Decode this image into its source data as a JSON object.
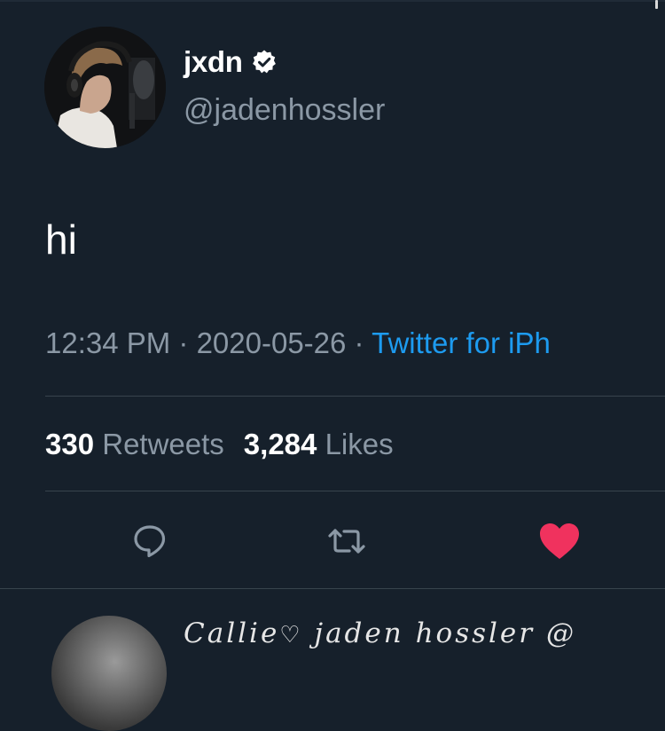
{
  "tweet": {
    "display_name": "jxdn",
    "handle": "@jadenhossler",
    "text": "hi",
    "time": "12:34 PM",
    "separator1": " · ",
    "date": "2020-05-26",
    "separator2": " · ",
    "source": "Twitter for iPh"
  },
  "stats": {
    "retweets_count": "330",
    "retweets_label": "Retweets",
    "likes_count": "3,284",
    "likes_label": "Likes"
  },
  "reply_preview": {
    "name": "Callie",
    "heart": "♡",
    "text": " jaden hossler @"
  },
  "colors": {
    "background": "#16202b",
    "secondary_text": "#8b98a5",
    "link": "#1d9bf0",
    "like": "#f0325e",
    "divider": "#38444d"
  },
  "icons": {
    "verified": "verified-badge-icon",
    "reply": "reply-icon",
    "retweet": "retweet-icon",
    "like": "heart-icon"
  }
}
